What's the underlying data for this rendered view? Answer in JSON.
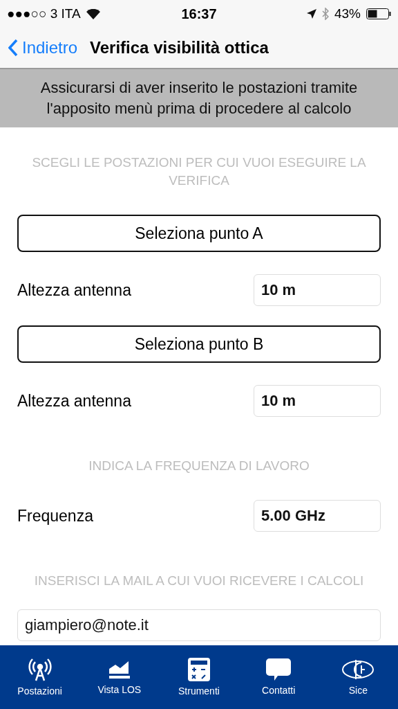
{
  "status_bar": {
    "carrier": "●●●○○ 3 ITA",
    "time": "16:37",
    "battery": "43%"
  },
  "nav": {
    "back": "Indietro",
    "title": "Verifica visibilità ottica"
  },
  "notice": "Assicurarsi di aver inserito le postazioni tramite l'apposito menù prima di procedere al calcolo",
  "form": [
    {
      "kind": "header",
      "text": "SCEGLI LE POSTAZIONI PER CUI VUOI ESEGUIRE LA VERIFICA"
    },
    {
      "kind": "button",
      "text": "Seleziona punto A"
    },
    {
      "kind": "field",
      "label": "Altezza antenna",
      "value": "10 m"
    },
    {
      "kind": "button",
      "text": "Seleziona punto B"
    },
    {
      "kind": "field",
      "label": "Altezza antenna",
      "value": "10 m"
    },
    {
      "kind": "header",
      "text": "INDICA LA FREQUENZA DI LAVORO"
    },
    {
      "kind": "field",
      "label": "Frequenza",
      "value": "5.00 GHz"
    },
    {
      "kind": "header",
      "text": "INSERISCI LA MAIL A CUI VUOI RICEVERE I CALCOLI"
    },
    {
      "kind": "email",
      "value": "giampiero@note.it"
    }
  ],
  "tab_bar": [
    {
      "label": "Postazioni"
    },
    {
      "label": "Vista LOS"
    },
    {
      "label": "Strumenti"
    },
    {
      "label": "Contatti"
    },
    {
      "label": "Sice"
    }
  ]
}
